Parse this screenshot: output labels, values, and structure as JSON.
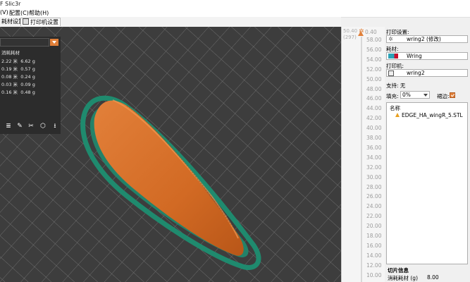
{
  "window": {
    "title": "F Slic3r"
  },
  "menu": [
    {
      "label": "(V)",
      "x": 0
    },
    {
      "label": "配置(C)",
      "x": 12
    },
    {
      "label": "帮助(H)",
      "x": 40
    }
  ],
  "tabs": [
    {
      "label": "耗材设置"
    },
    {
      "label": "打印机设置"
    }
  ],
  "left_panel": {
    "header": "消耗耗材",
    "rows": [
      {
        "length": "2.22 米",
        "weight": "6.62 g"
      },
      {
        "length": "0.19 米",
        "weight": "0.57 g"
      },
      {
        "length": "0.08 米",
        "weight": "0.24 g"
      },
      {
        "length": "0.03 米",
        "weight": "0.09 g"
      },
      {
        "length": "0.16 米",
        "weight": "0.48 g"
      }
    ],
    "tools": [
      "layers-icon",
      "paint-icon",
      "cut-icon",
      "cube-icon",
      "arrow-down-icon"
    ]
  },
  "slider": {
    "top_value": "50.40",
    "top_layer": "(297)",
    "current_value": "0.40",
    "ticks": [
      "58.00",
      "56.00",
      "54.00",
      "52.00",
      "50.00",
      "48.00",
      "46.00",
      "44.00",
      "42.00",
      "40.00",
      "38.00",
      "36.00",
      "34.00",
      "32.00",
      "30.00",
      "28.00",
      "26.00",
      "24.00",
      "22.00",
      "20.00",
      "18.00",
      "16.00",
      "14.00",
      "12.00",
      "10.00"
    ]
  },
  "right_panel": {
    "print_settings_label": "打印设置:",
    "print_settings_value": "wring2 (修改)",
    "filament_label": "耗材:",
    "filament_value": "Wring",
    "printer_label": "打印机:",
    "printer_value": "wring2",
    "support_label": "支持:",
    "support_value": "无",
    "infill_label": "填充:",
    "infill_value": "0%",
    "brim_label": "裙边:",
    "brim_checked": true,
    "list_header": "名称",
    "object_name": "EDGE_HA_wingR_5.STL",
    "slice_info_title": "切片信息",
    "used_filament_label": "消耗耗材 (g)",
    "used_filament_value": "8.00"
  },
  "colors": {
    "accent": "#e0803a",
    "part": "#d8702a",
    "brim": "#1f8a6e",
    "bed": "#3d3d3d"
  }
}
